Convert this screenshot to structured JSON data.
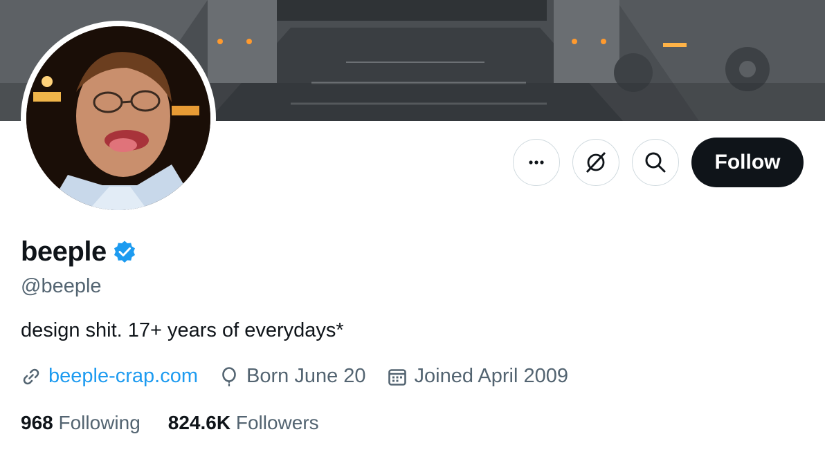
{
  "profile": {
    "name": "beeple",
    "handle": "@beeple",
    "bio": "design shit. 17+ years of everydays*",
    "website": "beeple-crap.com",
    "birthday": "Born June 20",
    "joined": "Joined April 2009",
    "following_count": "968",
    "following_label": "Following",
    "followers_count": "824.6K",
    "followers_label": "Followers"
  },
  "actions": {
    "more_icon": "more-horizontal-icon",
    "grok_icon": "grok-icon",
    "search_icon": "search-icon",
    "follow_label": "Follow"
  },
  "colors": {
    "accent": "#1d9bf0",
    "text": "#0f1419",
    "secondary": "#536471",
    "button": "#0f1419"
  }
}
